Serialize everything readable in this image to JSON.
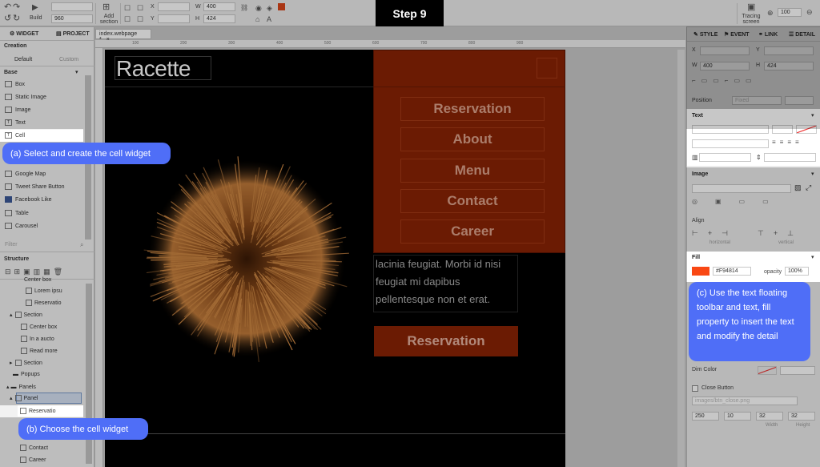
{
  "step": {
    "label": "Step 9"
  },
  "toolbar": {
    "build_label": "Build",
    "width_value": "960",
    "add_section_label": "Add section",
    "x_label": "X",
    "y_label": "Y",
    "w_label": "W",
    "h_label": "H",
    "w_value": "400",
    "h_value": "424",
    "tracing_label": "Tracing screen",
    "zoom_value": "100",
    "accent_color": "#d9461a"
  },
  "left_panel": {
    "tab_widget": "WIDGET",
    "tab_project": "PROJECT",
    "creation_label": "Creation",
    "default_tab": "Default",
    "custom_tab": "Custom",
    "base_label": "Base",
    "widgets": [
      "Box",
      "Static Image",
      "Image",
      "Text",
      "Cell",
      "Google Map",
      "Tweet Share Button",
      "Facebook Like",
      "Table",
      "Carousel"
    ],
    "filter_placeholder": "Filter",
    "structure_label": "Structure",
    "tree": [
      "Center box",
      "Lorem ipsu",
      "Reservatio",
      "Section",
      "Center box",
      "In a aucto",
      "Read more",
      "Section",
      "Popups",
      "Panels",
      "Panel",
      "Reservatio",
      "Contact",
      "Career"
    ]
  },
  "document": {
    "tab_label": "index.webpage *",
    "ruler_marks": [
      "100",
      "200",
      "300",
      "400",
      "500",
      "600",
      "700",
      "800",
      "900"
    ]
  },
  "page": {
    "logo": "Racette",
    "menu_items": [
      "Reservation",
      "About",
      "Menu",
      "Contact",
      "Career"
    ],
    "body_lines": [
      "lacinia feugiat. Morbi id nisi",
      "feugiat mi dapibus",
      "pellentesque non et erat."
    ],
    "cta_label": "Reservation",
    "menu_color": "#8a2304"
  },
  "right_panel": {
    "tab_style": "STYLE",
    "tab_event": "EVENT",
    "tab_link": "LINK",
    "tab_detail": "DETAIL",
    "x_label": "X",
    "y_label": "Y",
    "w_label": "W",
    "h_label": "H",
    "w_value": "400",
    "h_value": "424",
    "position_label": "Position",
    "position_value": "Fixed",
    "text_label": "Text",
    "image_label": "Image",
    "align_label": "Align",
    "horizontal_label": "horizontal",
    "vertical_label": "vertical",
    "fill_label": "Fill",
    "fill_hex": "#F94814",
    "fill_color": "#f94814",
    "opacity_label": "opacity",
    "opacity_value": "100%",
    "dim_color_label": "Dim Color",
    "close_button_label": "Close Button",
    "close_image": "images/btn_close.png",
    "close_values": [
      "250",
      "10",
      "32",
      "32"
    ],
    "width_label": "Width",
    "height_label": "Height"
  },
  "annotations": {
    "a": "(a) Select and create the cell widget",
    "b": "(b) Choose the cell widget",
    "c": "(c) Use the text floating toolbar and text, fill property to insert the text and modify the detail"
  }
}
